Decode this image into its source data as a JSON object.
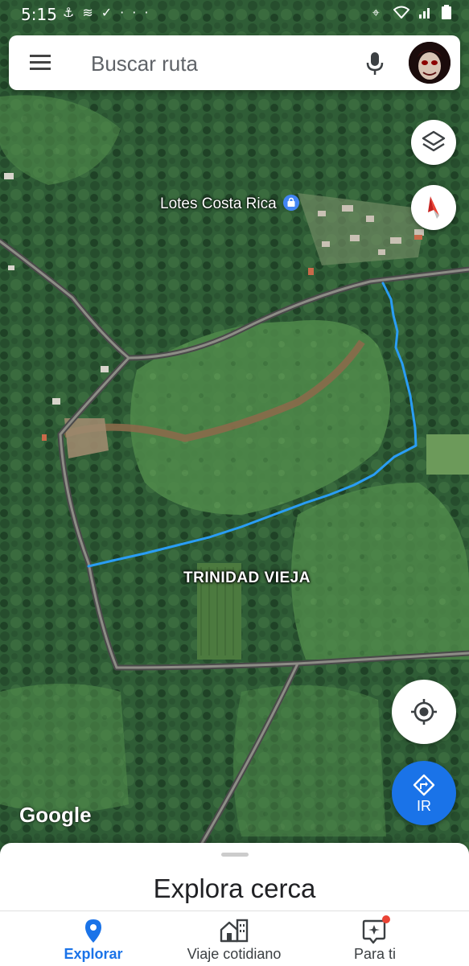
{
  "status_bar": {
    "time": "5:15",
    "left_icons": [
      "anchor-icon",
      "layers-stack-icon",
      "check-flag-icon",
      "more-dots-icon"
    ],
    "right_icons": [
      "location-pin-icon",
      "wifi-icon",
      "signal-icon",
      "battery-icon"
    ]
  },
  "search": {
    "placeholder": "Buscar ruta"
  },
  "map": {
    "poi_label": "Lotes Costa Rica",
    "area_label": "TRINIDAD VIEJA",
    "attribution": "Google"
  },
  "go_button": {
    "label": "IR"
  },
  "sheet": {
    "title": "Explora cerca"
  },
  "bottom_nav": {
    "items": [
      {
        "label": "Explorar",
        "icon": "location-pin-icon",
        "active": true
      },
      {
        "label": "Viaje cotidiano",
        "icon": "commute-icon",
        "active": false
      },
      {
        "label": "Para ti",
        "icon": "sparkle-icon",
        "active": false
      }
    ]
  },
  "colors": {
    "accent": "#1a73e8",
    "route": "#2a9df4",
    "notification_dot": "#ea4335"
  }
}
